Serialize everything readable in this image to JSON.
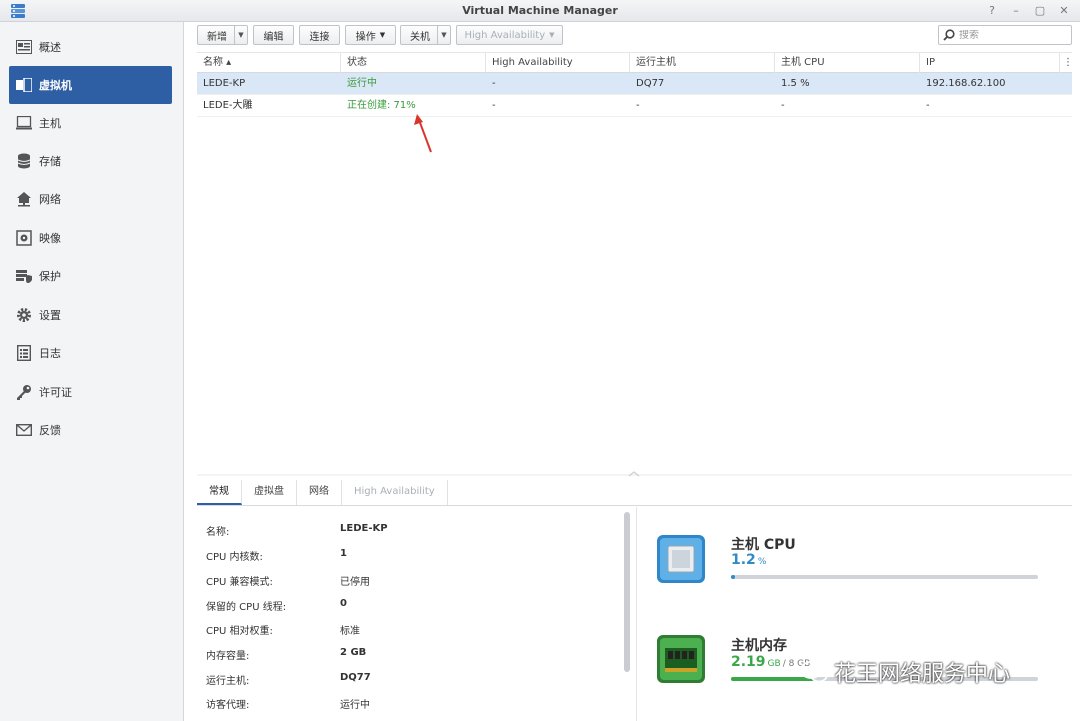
{
  "window": {
    "title": "Virtual Machine Manager",
    "controls": [
      "?",
      "–",
      "▢",
      "✕"
    ]
  },
  "sidebar": {
    "items": [
      {
        "label": "概述",
        "icon": "overview-icon"
      },
      {
        "label": "虚拟机",
        "icon": "virtual-machine-icon",
        "active": true
      },
      {
        "label": "主机",
        "icon": "host-icon"
      },
      {
        "label": "存储",
        "icon": "storage-icon"
      },
      {
        "label": "网络",
        "icon": "network-icon"
      },
      {
        "label": "映像",
        "icon": "image-icon"
      },
      {
        "label": "保护",
        "icon": "protection-icon"
      },
      {
        "label": "设置",
        "icon": "gear-icon"
      },
      {
        "label": "日志",
        "icon": "log-icon"
      },
      {
        "label": "许可证",
        "icon": "key-icon"
      },
      {
        "label": "反馈",
        "icon": "mail-icon"
      }
    ]
  },
  "toolbar": {
    "create": "新增",
    "edit": "编辑",
    "connect": "连接",
    "action": "操作",
    "shutdown": "关机",
    "ha": "High Availability",
    "search_placeholder": "搜索"
  },
  "table": {
    "headers": [
      "名称 ▴",
      "状态",
      "High Availability",
      "运行主机",
      "主机 CPU",
      "IP"
    ],
    "rows": [
      {
        "name": "LEDE-KP",
        "status": "运行中",
        "ha": "-",
        "host": "DQ77",
        "cpu": "1.5 %",
        "ip": "192.168.62.100"
      },
      {
        "name": "LEDE-大雕",
        "status": "正在创建: 71%",
        "ha": "-",
        "host": "-",
        "cpu": "-",
        "ip": "-"
      }
    ]
  },
  "detail_tabs": [
    "常规",
    "虚拟盘",
    "网络",
    "High Availability"
  ],
  "details": [
    {
      "label": "名称:",
      "value": "LEDE-KP"
    },
    {
      "label": "CPU 内核数:",
      "value": "1"
    },
    {
      "label": "CPU 兼容模式:",
      "value": "已停用"
    },
    {
      "label": "保留的 CPU 线程:",
      "value": "0"
    },
    {
      "label": "CPU 相对权重:",
      "value": "标准"
    },
    {
      "label": "内存容量:",
      "value": "2 GB"
    },
    {
      "label": "运行主机:",
      "value": "DQ77"
    },
    {
      "label": "访客代理:",
      "value": "运行中"
    }
  ],
  "resources": {
    "cpu": {
      "title": "主机 CPU",
      "value": "1.2",
      "unit": "%",
      "fraction": 0.012,
      "color": "#2e8bc9"
    },
    "memory": {
      "title": "主机内存",
      "value": "2.19",
      "unit": "GB",
      "total": "/ 8 GB",
      "fraction": 0.27,
      "color": "#3aa84a"
    }
  },
  "watermark": "花王网络服务中心",
  "colors": {
    "accent": "#2e5ea3",
    "selected_row": "#d9e7f6",
    "status_green": "#3a9a3a"
  }
}
